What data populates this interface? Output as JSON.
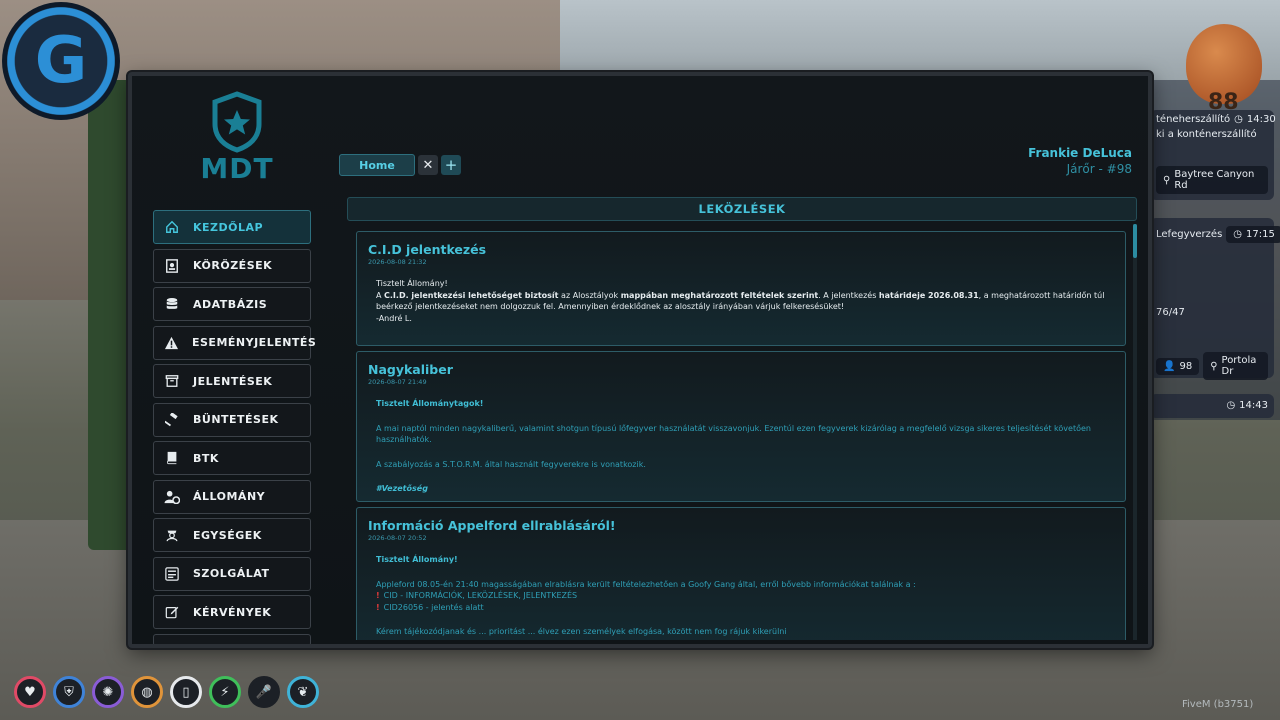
{
  "world": {
    "hud": {
      "line1": "téneherszállító",
      "line1_time": "14:30",
      "line2": "ki a konténerszállító",
      "location1": "Baytree Canyon Rd",
      "line3": "Lefegyverzés",
      "line3_time": "17:15",
      "counter": "76/47",
      "units": "98",
      "location2": "Portola Dr",
      "time3": "14:43"
    },
    "logo_right_number": "88",
    "fivem_label": "FiveM (b3751)"
  },
  "mdt": {
    "logo_text": "MDT",
    "user": {
      "name": "Frankie DeLuca",
      "role": "Járőr - #98"
    },
    "tabs": [
      {
        "label": "Home"
      }
    ],
    "nav": [
      {
        "label": "KEZDŐLAP",
        "icon": "home-icon",
        "active": true
      },
      {
        "label": "KÖRÖZÉSEK",
        "icon": "wanted-poster-icon"
      },
      {
        "label": "ADATBÁZIS",
        "icon": "database-icon"
      },
      {
        "label": "ESEMÉNYJELENTÉS",
        "icon": "warning-icon"
      },
      {
        "label": "JELENTÉSEK",
        "icon": "archive-icon"
      },
      {
        "label": "BÜNTETÉSEK",
        "icon": "gavel-icon"
      },
      {
        "label": "BTK",
        "icon": "book-icon"
      },
      {
        "label": "ÁLLOMÁNY",
        "icon": "users-cog-icon"
      },
      {
        "label": "EGYSÉGEK",
        "icon": "officer-icon"
      },
      {
        "label": "SZOLGÁLAT",
        "icon": "duty-icon"
      },
      {
        "label": "KÉRVÉNYEK",
        "icon": "edit-icon"
      }
    ],
    "section_title": "LEKÖZLÉSEK",
    "posts": [
      {
        "title": "C.I.D jelentkezés",
        "date": "2026-08-08 21:32",
        "greeting": "Tisztelt Állomány!",
        "body_a": "A ",
        "body_b": "C.I.D. jelentkezési lehetőséget biztosít",
        "body_c": " az Alosztályok ",
        "body_d": "mappában meghatározott feltételek szerint",
        "body_e": ". A jelentkezés ",
        "body_f": "határideje 2026.08.31",
        "body_g": ", a meghatározott határidőn túl beérkező jelentkezéseket nem dolgozzuk fel. Amennyiben érdeklődnek az alosztály irányában várjuk felkeresésüket!",
        "signature": "-André L."
      },
      {
        "title": "Nagykaliber",
        "date": "2026-08-07 21:49",
        "greeting": "Tisztelt Állománytagok!",
        "para1": "A mai naptól minden nagykaliberű, valamint shotgun típusú lőfegyver használatát visszavonjuk. Ezentúl ezen fegyverek kizárólag a megfelelő vizsga sikeres teljesítését követően használhatók.",
        "para2": "A szabályozás a S.T.O.R.M. által használt fegyverekre is vonatkozik.",
        "signature": "#Vezetőség"
      },
      {
        "title": "Információ Appelford ellrablásáról!",
        "date": "2026-08-07 20:52",
        "greeting": "Tisztelt Állomány!",
        "para1": "Appleford 08.05-én 21:40 magasságában elrablásra került feltételezhetően a Goofy Gang által, erről bővebb információkat találnak a :",
        "bullet1": "CID - INFORMÁCIÓK, LEKÖZLÉSEK, JELENTKEZÉS",
        "bullet2": "CID26056 - jelentés alatt",
        "para2": "Kérem tájékozódjanak és ... prioritást ... élvez ezen személyek elfogása, között nem fog rájuk kikerülni"
      }
    ]
  },
  "status_icons": [
    "health-icon",
    "armor-icon",
    "brain-icon",
    "food-icon",
    "water-icon",
    "stamina-icon",
    "microphone-icon",
    "lungs-icon"
  ],
  "status_colors": [
    "#e04a66",
    "#3f83d8",
    "#8a5cd6",
    "#e0943a",
    "#e6e9ec",
    "#3fbf5a",
    "#ededed",
    "#3fb3d8"
  ]
}
